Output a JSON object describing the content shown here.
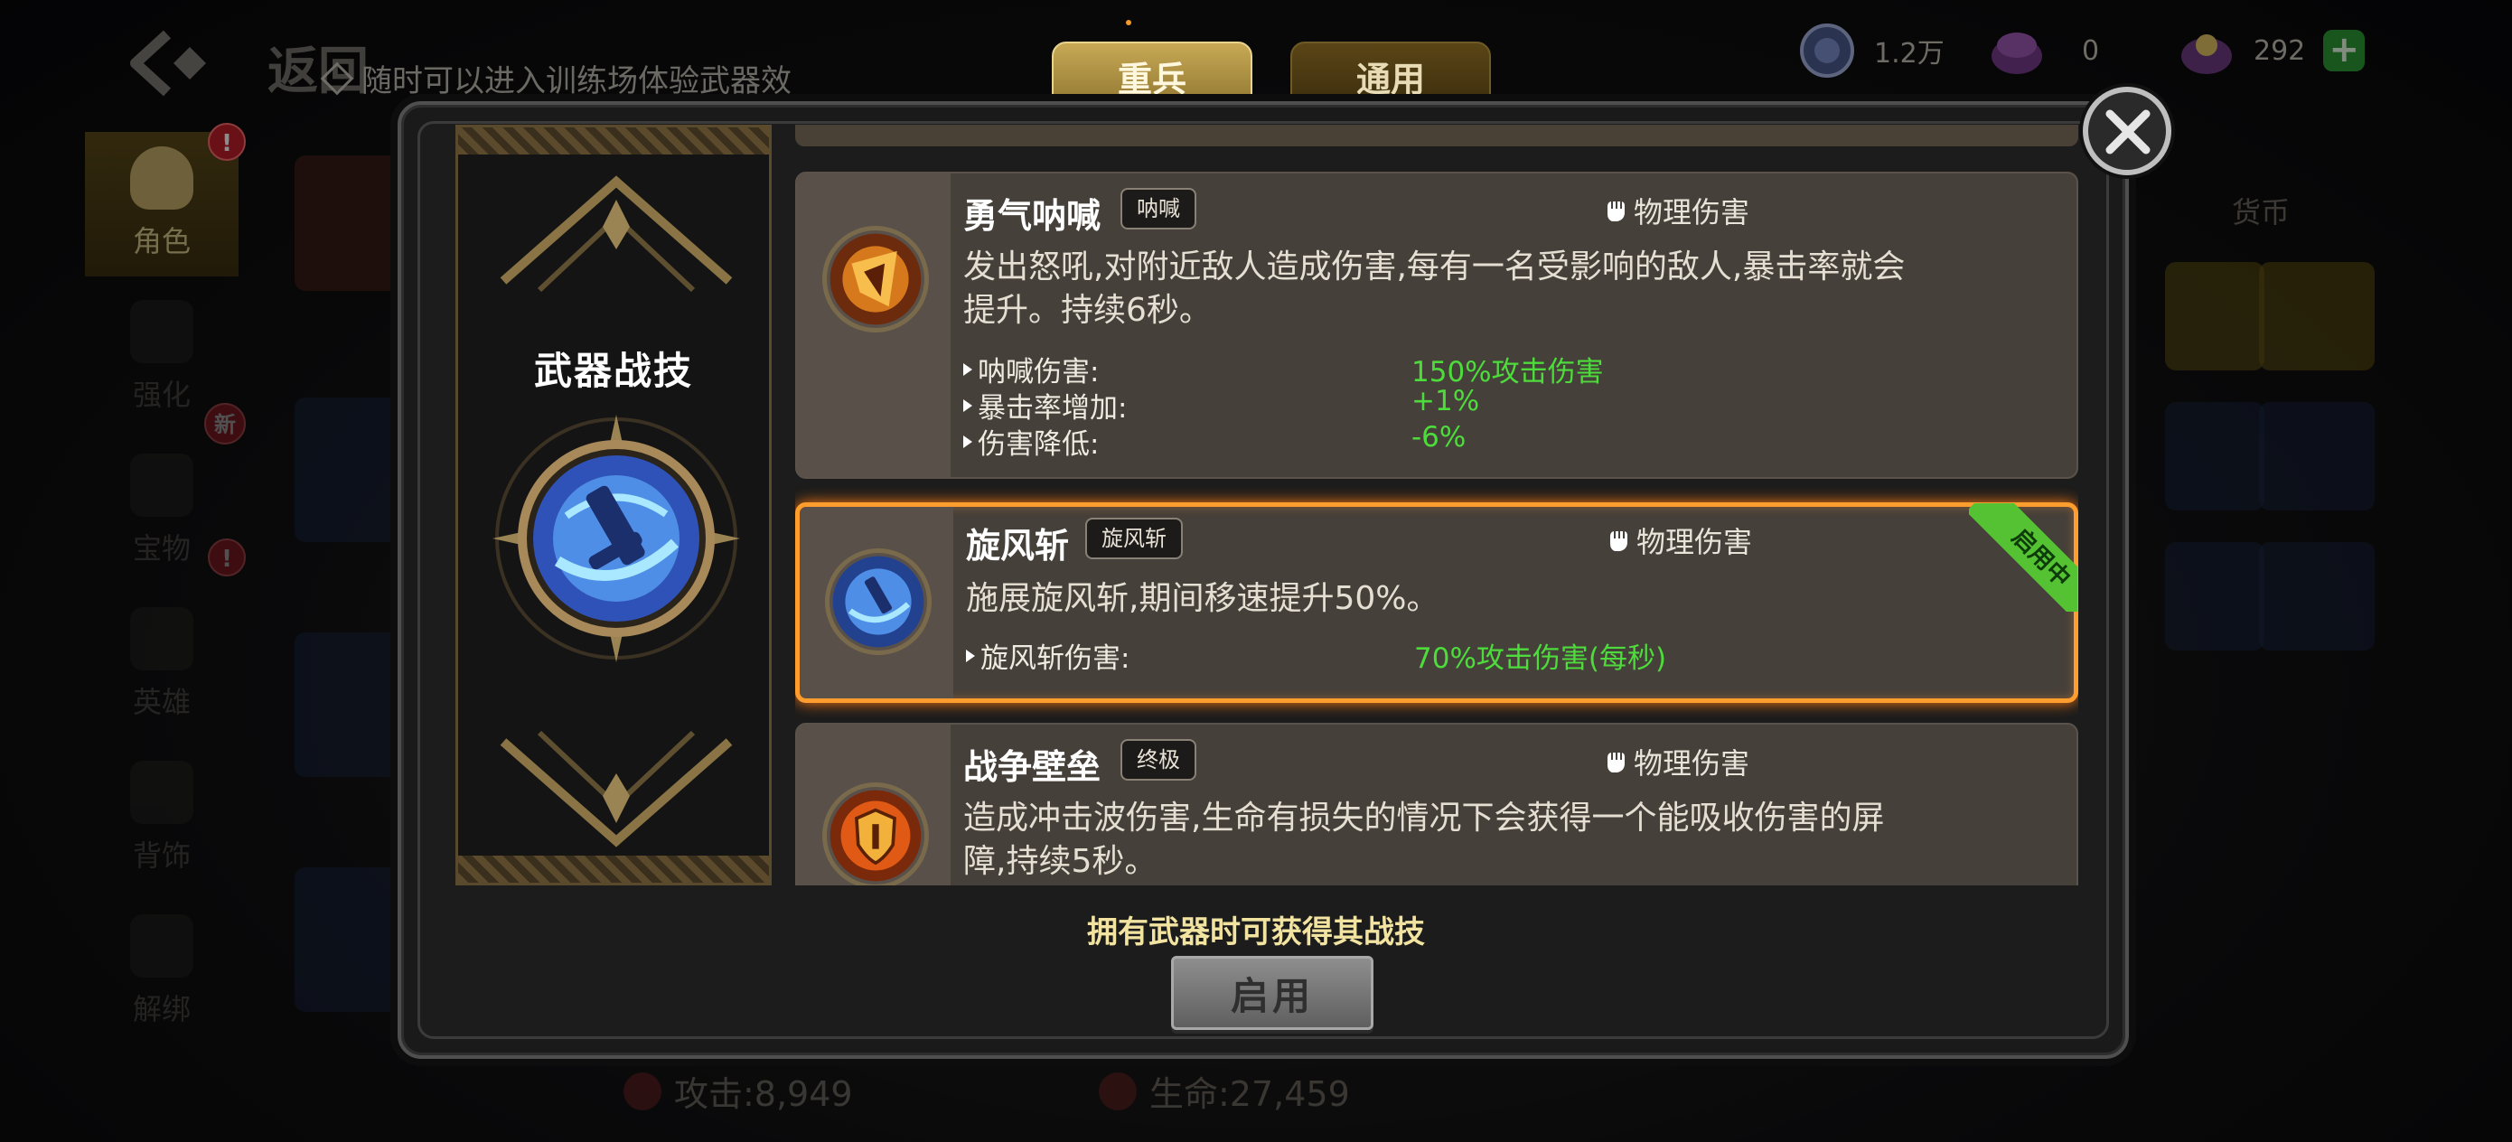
{
  "background": {
    "back_label": "返回",
    "hint": "随时可以进入训练场体验武器效",
    "currencies": [
      {
        "icon": "silver-coin-icon",
        "value": "1.2万"
      },
      {
        "icon": "purple-chest-icon",
        "value": "0"
      },
      {
        "icon": "gem-chest-icon",
        "value": "292"
      }
    ],
    "sidebar": [
      {
        "label": "角色",
        "icon": "character-icon",
        "active": true,
        "badge": "!"
      },
      {
        "label": "强化",
        "icon": "upgrade-icon",
        "active": false,
        "badge": "新"
      },
      {
        "label": "宝物",
        "icon": "treasure-icon",
        "active": false,
        "badge": "!"
      },
      {
        "label": "英雄",
        "icon": "hero-icon",
        "active": false,
        "badge": ""
      },
      {
        "label": "背饰",
        "icon": "wings-icon",
        "active": false,
        "badge": ""
      },
      {
        "label": "解绑",
        "icon": "scale-icon",
        "active": false,
        "badge": ""
      }
    ],
    "side_tab_label": "货币",
    "stats": {
      "attack": "攻击:8,949",
      "hp": "生命:27,459"
    }
  },
  "tabs": [
    {
      "label": "重兵",
      "active": true
    },
    {
      "label": "通用",
      "active": false
    }
  ],
  "left_panel": {
    "title": "武器战技"
  },
  "skills": [
    {
      "name": "勇气呐喊",
      "tag": "呐喊",
      "damage_type": "物理伤害",
      "description": "发出怒吼,对附近敌人造成伤害,每有一名受影响的敌人,暴击率就会提升。持续6秒。",
      "stats": [
        {
          "label": "呐喊伤害:",
          "value": "150%攻击伤害"
        },
        {
          "label": "暴击率增加:",
          "value": "+1%"
        },
        {
          "label": "伤害降低:",
          "value": "-6%"
        }
      ],
      "selected": false
    },
    {
      "name": "旋风斩",
      "tag": "旋风斩",
      "damage_type": "物理伤害",
      "description": "施展旋风斩,期间移速提升50%。",
      "stats": [
        {
          "label": "旋风斩伤害:",
          "value": "70%攻击伤害(每秒)"
        }
      ],
      "selected": true,
      "ribbon": "启用中"
    },
    {
      "name": "战争壁垒",
      "tag": "终极",
      "damage_type": "物理伤害",
      "description": "造成冲击波伤害,生命有损失的情况下会获得一个能吸收伤害的屏障,持续5秒。",
      "stats": [],
      "selected": false
    }
  ],
  "footer": {
    "note": "拥有武器时可获得其战技",
    "enable_button": "启用"
  },
  "colors": {
    "accent_gold": "#c7a955",
    "selected_border": "#ff9d2e",
    "stat_green": "#4ddc3c",
    "ribbon_green": "#54c232"
  }
}
